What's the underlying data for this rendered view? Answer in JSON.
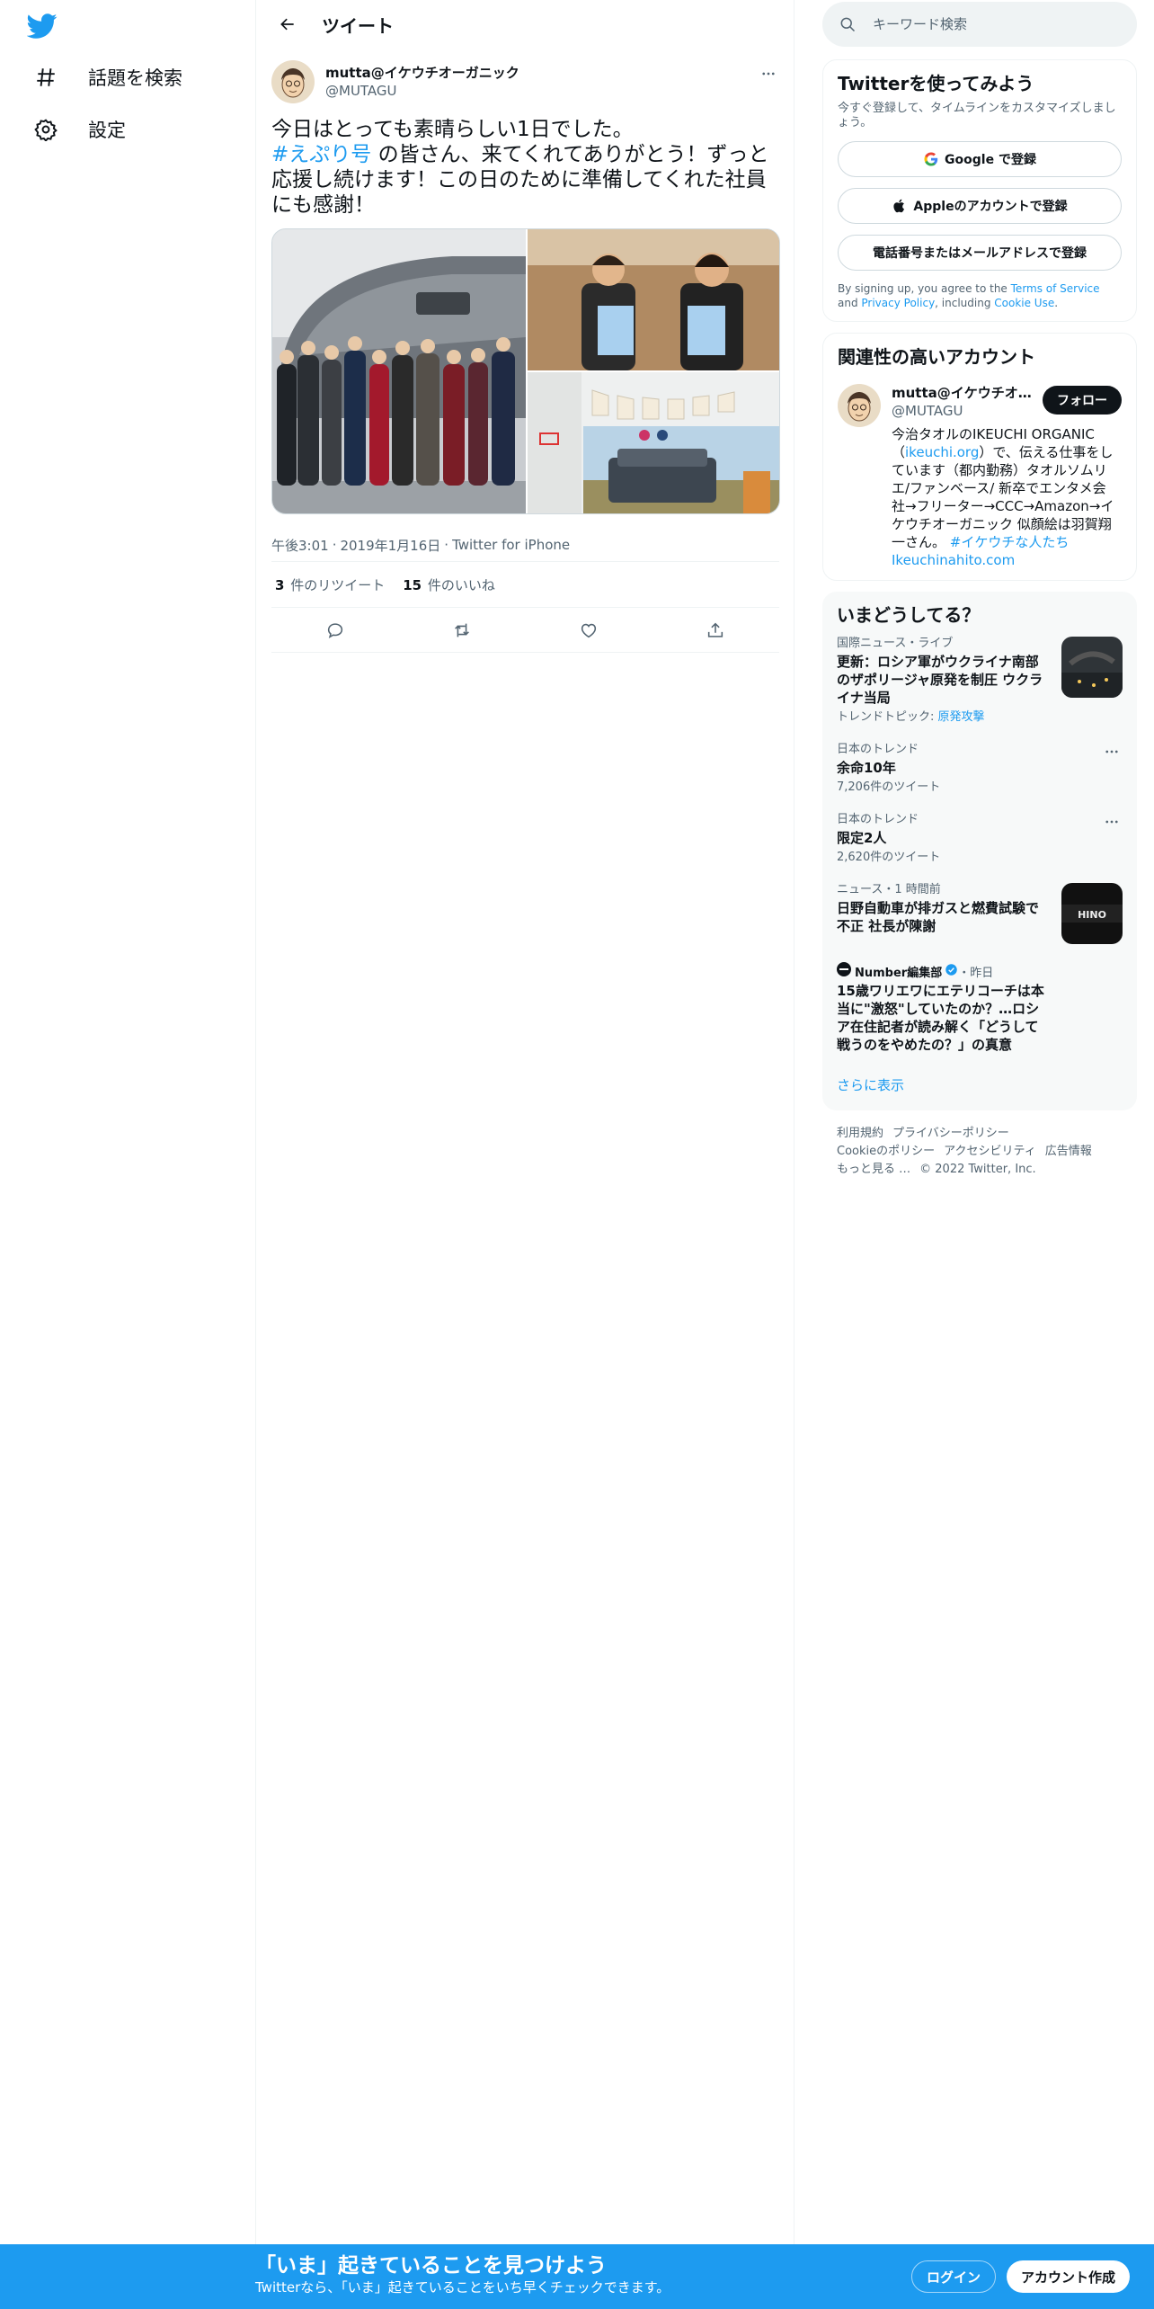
{
  "nav": {
    "items": [
      {
        "label": "話題を検索",
        "icon": "hashtag-icon"
      },
      {
        "label": "設定",
        "icon": "gear-icon"
      }
    ]
  },
  "header": {
    "title": "ツイート"
  },
  "tweet": {
    "author_name": "mutta@イケウチオーガニック",
    "author_handle": "@MUTAGU",
    "text_line1": "今日はとっても素晴らしい1日でした。",
    "hashtag": "#えぷり号",
    "text_rest": " の皆さん、来てくれてありがとう！ずっと応援し続けます！この日のために準備してくれた社員にも感謝！",
    "time": "午後3:01",
    "date": "2019年1月16日",
    "source": "Twitter for iPhone",
    "retweet_count": "3",
    "retweet_label": "件のリツイート",
    "like_count": "15",
    "like_label": "件のいいね"
  },
  "search": {
    "placeholder": "キーワード検索"
  },
  "signup_card": {
    "title": "Twitterを使ってみよう",
    "subtitle": "今すぐ登録して、タイムラインをカスタマイズしましょう。",
    "google_label": "Google で登録",
    "apple_label": "Appleのアカウントで登録",
    "phone_label": "電話番号またはメールアドレスで登録",
    "terms_prefix": "By signing up, you agree to the ",
    "terms_link": "Terms of Service",
    "terms_and": " and ",
    "privacy_link": "Privacy Policy",
    "terms_including": ", including ",
    "cookie_link": "Cookie Use",
    "terms_end": "."
  },
  "related": {
    "title": "関連性の高いアカウント",
    "name": "mutta@イケウチオーガニック",
    "handle": "@MUTAGU",
    "follow_label": "フォロー",
    "bio_1": "今治タオルのIKEUCHI ORGANIC（",
    "bio_link1": "ikeuchi.org",
    "bio_2": "）で、伝える仕事をしています（都内勤務）タオルソムリエ/ファンベース/ 新卒でエンタメ会社→フリーター→CCC→Amazon→イケウチオーガニック 似顔絵は羽賀翔一さん。",
    "bio_link2": "#イケウチな人たち",
    "bio_link3": "Ikeuchinahito.com"
  },
  "trends": {
    "title": "いまどうしてる？",
    "items": [
      {
        "category": "国際ニュース・ライブ",
        "title": "更新：ロシア軍がウクライナ南部のザポリージャ原発を制圧 ウクライナ当局",
        "footer_prefix": "トレンドトピック: ",
        "footer_link": "原発攻撃"
      },
      {
        "category": "日本のトレンド",
        "title": "余命10年",
        "footer": "7,206件のツイート"
      },
      {
        "category": "日本のトレンド",
        "title": "限定2人",
        "footer": "2,620件のツイート"
      },
      {
        "category": "ニュース・1 時間前",
        "title": "日野自動車が排ガスと燃費試験で不正 社長が陳謝"
      },
      {
        "source": "Number編集部",
        "time": "・昨日",
        "title": "15歳ワリエワにエテリコーチは本当に\"激怒\"していたのか？…ロシア在住記者が読み解く「どうして戦うのをやめたの？」の真意"
      }
    ],
    "show_more": "さらに表示"
  },
  "footer": {
    "links": [
      "利用規約",
      "プライバシーポリシー",
      "Cookieのポリシー",
      "アクセシビリティ",
      "広告情報",
      "もっと見る …"
    ],
    "copyright": "© 2022 Twitter, Inc."
  },
  "bottom_bar": {
    "title": "「いま」起きていることを見つけよう",
    "subtitle": "Twitterなら、「いま」起きていることをいち早くチェックできます。",
    "login_label": "ログイン",
    "signup_label": "アカウント作成"
  },
  "colors": {
    "accent": "#1d9bf0",
    "text": "#0f1419",
    "secondary": "#536471"
  }
}
